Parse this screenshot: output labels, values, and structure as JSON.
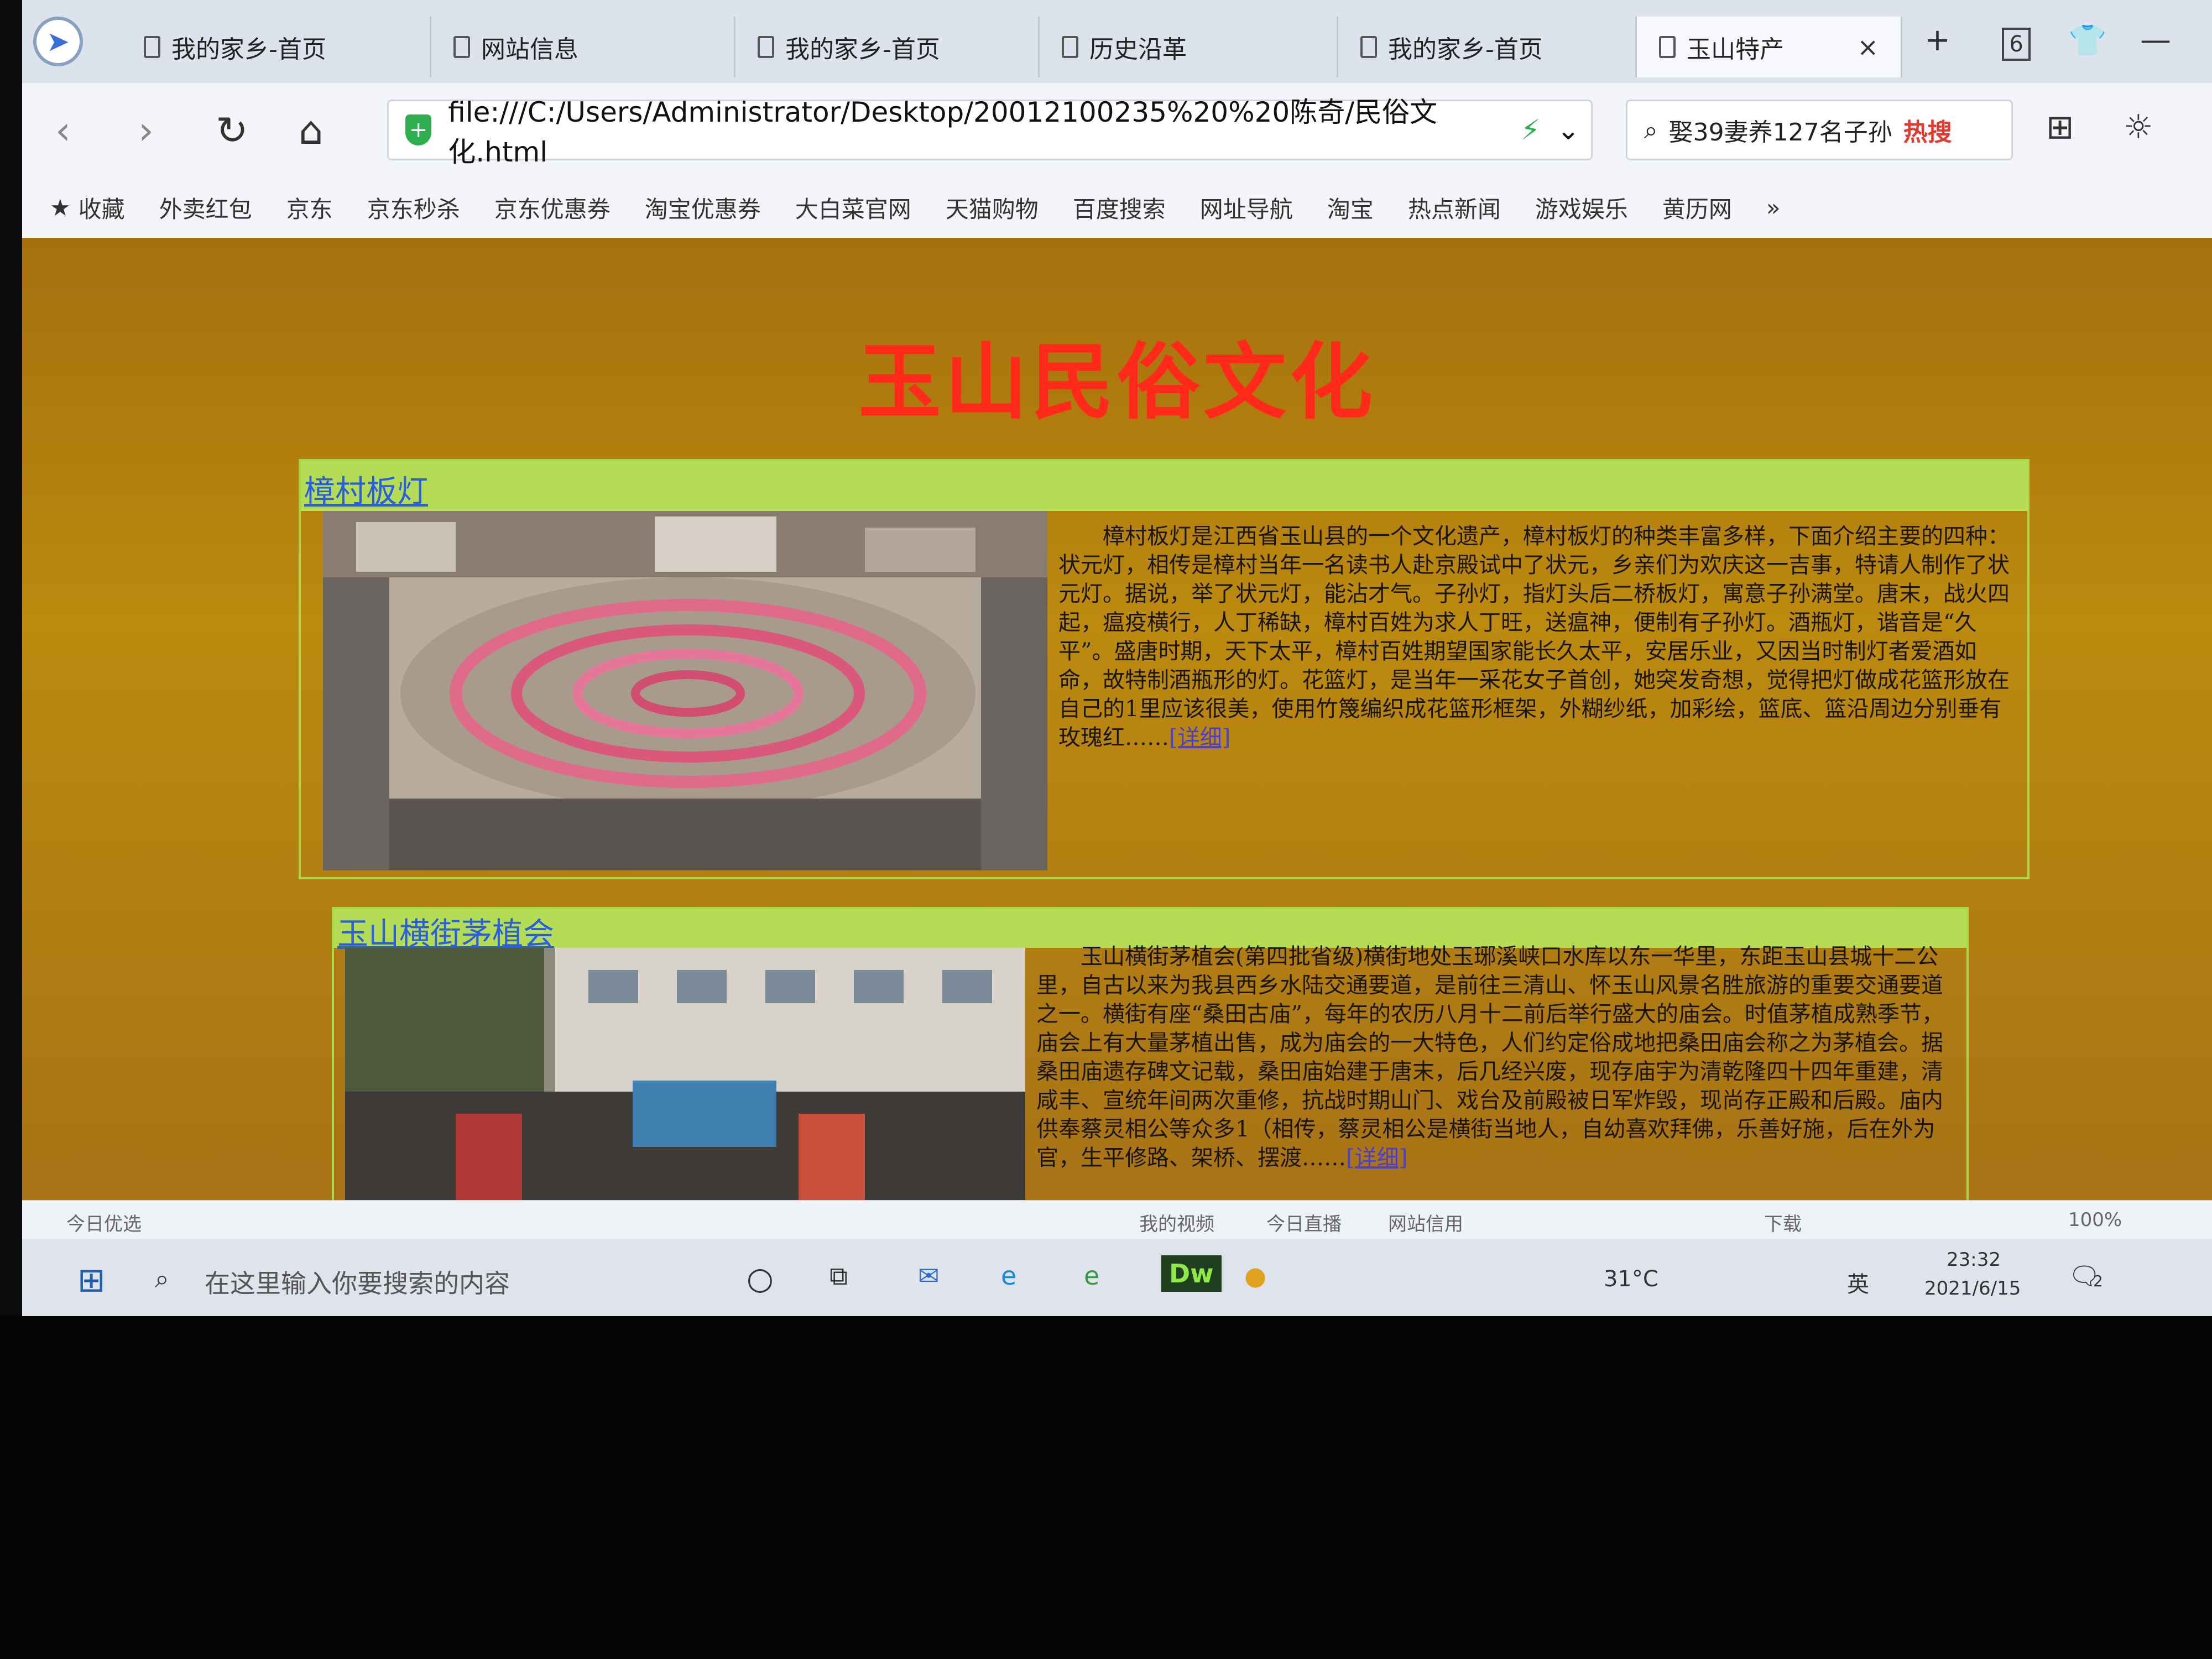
{
  "browser": {
    "tabs": [
      {
        "label": "我的家乡-首页"
      },
      {
        "label": "网站信息"
      },
      {
        "label": "我的家乡-首页"
      },
      {
        "label": "历史沿革"
      },
      {
        "label": "我的家乡-首页"
      },
      {
        "label": "玉山特产",
        "active": true
      }
    ],
    "new_tab": "+",
    "tab_count": "6",
    "url": "file:///C:/Users/Administrator/Desktop/20012100235%20%20陈奇/民俗文化.html",
    "search_text": "娶39妻养127名子孙",
    "search_badge": "热搜",
    "bookmarks": [
      "收藏",
      "外卖红包",
      "京东",
      "京东秒杀",
      "京东优惠券",
      "淘宝优惠券",
      "大白菜官网",
      "天猫购物",
      "百度搜索",
      "网址导航",
      "淘宝",
      "热点新闻",
      "游戏娱乐",
      "黄历网"
    ],
    "more_bookmarks": "»"
  },
  "page": {
    "title": "玉山民俗文化",
    "sections": [
      {
        "heading": "樟村板灯",
        "text": "樟村板灯是江西省玉山县的一个文化遗产，樟村板灯的种类丰富多样，下面介绍主要的四种：状元灯，相传是樟村当年一名读书人赴京殿试中了状元，乡亲们为欢庆这一吉事，特请人制作了状元灯。据说，举了状元灯，能沾才气。子孙灯，指灯头后二桥板灯，寓意子孙满堂。唐末，战火四起，瘟疫横行，人丁稀缺，樟村百姓为求人丁旺，送瘟神，便制有子孙灯。酒瓶灯，谐音是“久平”。盛唐时期，天下太平，樟村百姓期望国家能长久太平，安居乐业，又因当时制灯者爱酒如命，故特制酒瓶形的灯。花篮灯，是当年一采花女子首创，她突发奇想，觉得把灯做成花篮形放在自己的1里应该很美，使用竹篾编织成花篮形框架，外糊纱纸，加彩绘，篮底、篮沿周边分别垂有玫瑰红……",
        "more": "[详细]"
      },
      {
        "heading": "玉山横街茅植会",
        "text": "玉山横街茅植会(第四批省级)横街地处玉琊溪峡口水库以东一华里，东距玉山县城十二公里，自古以来为我县西乡水陆交通要道，是前往三清山、怀玉山风景名胜旅游的重要交通要道之一。横街有座“桑田古庙”，每年的农历八月十二前后举行盛大的庙会。时值茅植成熟季节，庙会上有大量茅植出售，成为庙会的一大特色，人们约定俗成地把桑田庙会称之为茅植会。据桑田庙遗存碑文记载，桑田庙始建于唐末，后几经兴废，现存庙宇为清乾隆四十四年重建，清咸丰、宣统年间两次重修，抗战时期山门、戏台及前殿被日军炸毁，现尚存正殿和后殿。庙内供奉蔡灵相公等众多1（相传，蔡灵相公是横街当地人，自幼喜欢拜佛，乐善好施，后在外为官，生平修路、架桥、摆渡……",
        "more": "[详细]"
      }
    ]
  },
  "statusbar": {
    "left": "今日优选",
    "items": [
      "我的视频",
      "今日直播",
      "网站信用",
      "下载"
    ],
    "zoom": "100%"
  },
  "taskbar": {
    "search_placeholder": "在这里输入你要搜索的内容",
    "temperature": "31°C",
    "ime": "英",
    "time": "23:32",
    "date": "2021/6/15",
    "dw_label": "Dw",
    "notification_count": "2"
  }
}
